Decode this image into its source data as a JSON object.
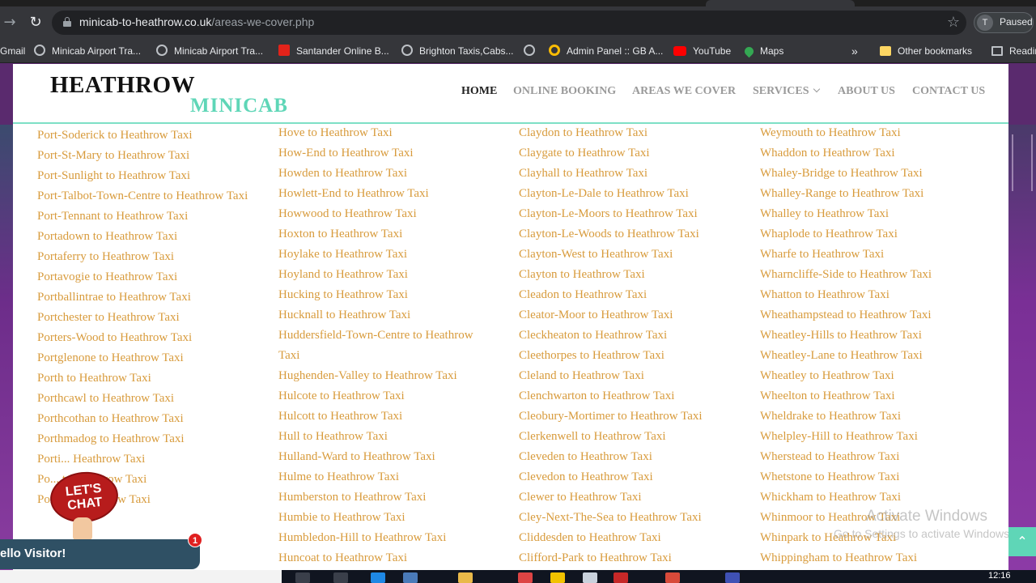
{
  "browser": {
    "url_domain": "minicab-to-heathrow.co.uk",
    "url_path": "/areas-we-cover.php",
    "profile_initial": "T",
    "profile_status": "Paused",
    "bookmarks": [
      "Gmail",
      "Minicab Airport Tra...",
      "Minicab Airport Tra...",
      "Santander Online B...",
      "Brighton Taxis,Cabs...",
      "",
      "Admin Panel :: GB A...",
      "YouTube",
      "Maps"
    ],
    "bookmarks_overflow": "»",
    "other_bookmarks": "Other bookmarks",
    "reading_list": "Readin"
  },
  "site": {
    "logo_top": "HEATHROW",
    "logo_bottom": "MINICAB",
    "nav": [
      "HOME",
      "ONLINE BOOKING",
      "AREAS WE COVER",
      "SERVICES",
      "ABOUT US",
      "CONTACT US"
    ]
  },
  "areas": {
    "col1": [
      "Port-Soderick to Heathrow Taxi",
      "Port-St-Mary to Heathrow Taxi",
      "Port-Sunlight to Heathrow Taxi",
      "Port-Talbot-Town-Centre to Heathrow Taxi",
      "Port-Tennant to Heathrow Taxi",
      "Portadown to Heathrow Taxi",
      "Portaferry to Heathrow Taxi",
      "Portavogie to Heathrow Taxi",
      "Portballintrae to Heathrow Taxi",
      "Portchester to Heathrow Taxi",
      "Porters-Wood to Heathrow Taxi",
      "Portglenone to Heathrow Taxi",
      "Porth to Heathrow Taxi",
      "Porthcawl to Heathrow Taxi",
      "Porthcothan to Heathrow Taxi",
      "Porthmadog to Heathrow Taxi",
      "Porti... Heathrow Taxi",
      "Po... to Heathrow Taxi",
      "Portla... Heathrow Taxi"
    ],
    "col2": [
      "Hove to Heathrow Taxi",
      "How-End to Heathrow Taxi",
      "Howden to Heathrow Taxi",
      "Howlett-End to Heathrow Taxi",
      "Howwood to Heathrow Taxi",
      "Hoxton to Heathrow Taxi",
      "Hoylake to Heathrow Taxi",
      "Hoyland to Heathrow Taxi",
      "Hucking to Heathrow Taxi",
      "Hucknall to Heathrow Taxi",
      "Huddersfield-Town-Centre to Heathrow Taxi",
      "Hughenden-Valley to Heathrow Taxi",
      "Hulcote to Heathrow Taxi",
      "Hulcott to Heathrow Taxi",
      "Hull to Heathrow Taxi",
      "Hulland-Ward to Heathrow Taxi",
      "Hulme to Heathrow Taxi",
      "Humberston to Heathrow Taxi",
      "Humbie to Heathrow Taxi",
      "Humbledon-Hill to Heathrow Taxi",
      "Huncoat to Heathrow Taxi"
    ],
    "col3": [
      "Claydon to Heathrow Taxi",
      "Claygate to Heathrow Taxi",
      "Clayhall to Heathrow Taxi",
      "Clayton-Le-Dale to Heathrow Taxi",
      "Clayton-Le-Moors to Heathrow Taxi",
      "Clayton-Le-Woods to Heathrow Taxi",
      "Clayton-West to Heathrow Taxi",
      "Clayton to Heathrow Taxi",
      "Cleadon to Heathrow Taxi",
      "Cleator-Moor to Heathrow Taxi",
      "Cleckheaton to Heathrow Taxi",
      "Cleethorpes to Heathrow Taxi",
      "Cleland to Heathrow Taxi",
      "Clenchwarton to Heathrow Taxi",
      "Cleobury-Mortimer to Heathrow Taxi",
      "Clerkenwell to Heathrow Taxi",
      "Cleveden to Heathrow Taxi",
      "Clevedon to Heathrow Taxi",
      "Clewer to Heathrow Taxi",
      "Cley-Next-The-Sea to Heathrow Taxi",
      "Cliddesden to Heathrow Taxi",
      "Clifford-Park to Heathrow Taxi"
    ],
    "col4": [
      "Weymouth to Heathrow Taxi",
      "Whaddon to Heathrow Taxi",
      "Whaley-Bridge to Heathrow Taxi",
      "Whalley-Range to Heathrow Taxi",
      "Whalley to Heathrow Taxi",
      "Whaplode to Heathrow Taxi",
      "Wharfe to Heathrow Taxi",
      "Wharncliffe-Side to Heathrow Taxi",
      "Whatton to Heathrow Taxi",
      "Wheathampstead to Heathrow Taxi",
      "Wheatley-Hills to Heathrow Taxi",
      "Wheatley-Lane to Heathrow Taxi",
      "Wheatley to Heathrow Taxi",
      "Wheelton to Heathrow Taxi",
      "Wheldrake to Heathrow Taxi",
      "Whelpley-Hill to Heathrow Taxi",
      "Wherstead to Heathrow Taxi",
      "Whetstone to Heathrow Taxi",
      "Whickham to Heathrow Taxi",
      "Whinmoor to Heathrow Taxi",
      "Whinpark to Heathrow Taxi",
      "Whippingham to Heathrow Taxi"
    ]
  },
  "chat": {
    "bubble_line1": "LET'S",
    "bubble_line2": "CHAT",
    "greeting": "ello Visitor!",
    "unread_count": "1"
  },
  "windows": {
    "activate_title": "Activate Windows",
    "activate_sub": "Go to Settings to activate Windows.",
    "clock": "12:16"
  },
  "colors": {
    "link": "#d89b3c",
    "accent": "#5fd6b7",
    "chat": "#b71c1c"
  }
}
